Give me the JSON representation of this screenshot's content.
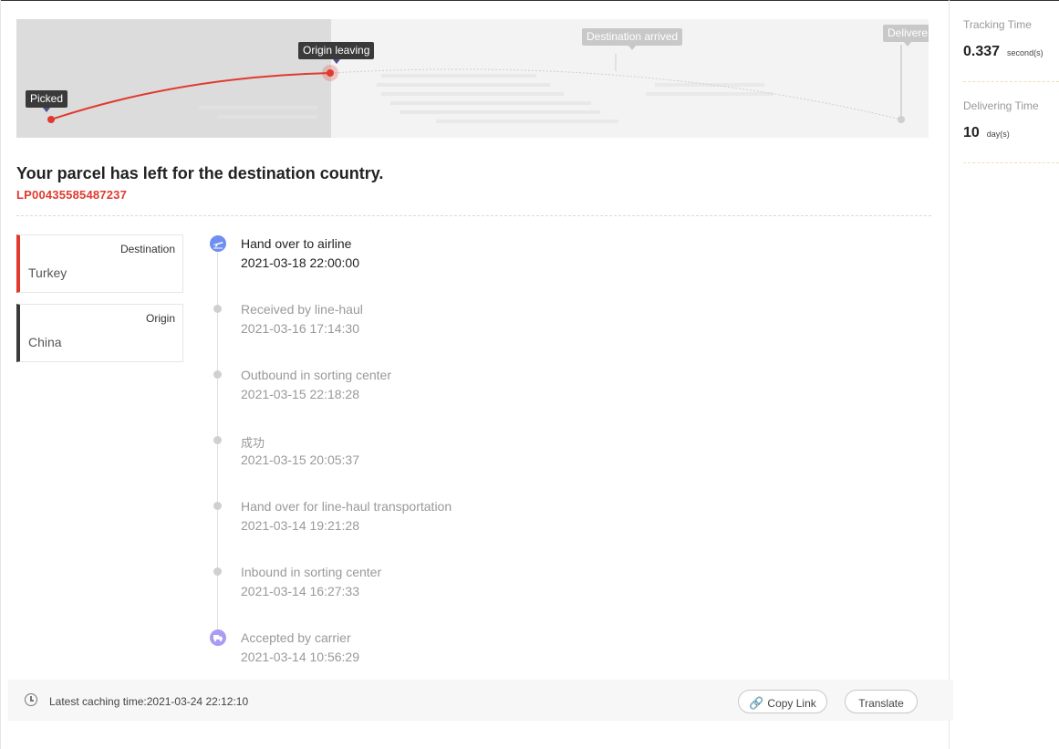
{
  "map": {
    "stages": [
      "Picked",
      "Origin leaving",
      "Destination arrived",
      "Delivere"
    ],
    "colors": {
      "route": "#e03a2e",
      "completed_bg": "#dcdcdc",
      "pending_bg": "#f3f3f3"
    }
  },
  "header": {
    "status_title": "Your parcel has left for the destination country.",
    "tracking_number": "LP00435585487237"
  },
  "countries": {
    "destination_label": "Destination",
    "destination_value": "Turkey",
    "origin_label": "Origin",
    "origin_value": "China"
  },
  "events": [
    {
      "status": "Hand over to airline",
      "time": "2021-03-18 22:00:00",
      "icon": "airplane-icon"
    },
    {
      "status": "Received by line-haul",
      "time": "2021-03-16 17:14:30",
      "icon": "dot"
    },
    {
      "status": "Outbound in sorting center",
      "time": "2021-03-15 22:18:28",
      "icon": "dot"
    },
    {
      "status": "成功",
      "time": "2021-03-15 20:05:37",
      "icon": "dot"
    },
    {
      "status": "Hand over for line-haul transportation",
      "time": "2021-03-14 19:21:28",
      "icon": "dot"
    },
    {
      "status": "Inbound in sorting center",
      "time": "2021-03-14 16:27:33",
      "icon": "dot"
    },
    {
      "status": "Accepted by carrier",
      "time": "2021-03-14 10:56:29",
      "icon": "truck-icon"
    }
  ],
  "footer": {
    "cache_text": "Latest caching time:2021-03-24 22:12:10",
    "copy_link_label": "Copy Link",
    "translate_label": "Translate"
  },
  "stats": {
    "tracking_time_label": "Tracking Time",
    "tracking_time_value": "0.337",
    "tracking_time_unit": "second(s)",
    "delivering_time_label": "Delivering Time",
    "delivering_time_value": "10",
    "delivering_time_unit": "day(s)"
  }
}
